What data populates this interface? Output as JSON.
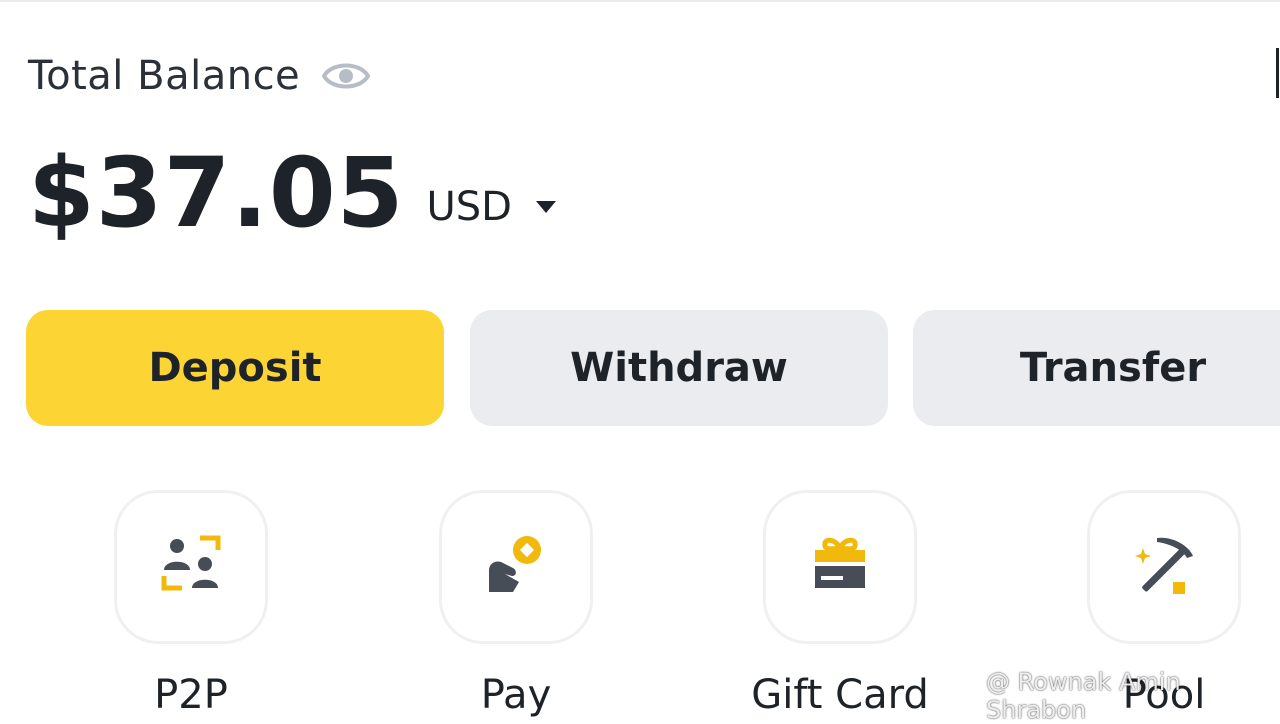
{
  "balance": {
    "label": "Total Balance",
    "amount": "$37.05",
    "currency": "USD"
  },
  "icons": {
    "visibility": "eye-icon",
    "currency_dropdown": "caret-down-icon"
  },
  "actions": {
    "deposit": "Deposit",
    "withdraw": "Withdraw",
    "transfer": "Transfer"
  },
  "shortcuts": [
    {
      "label": "P2P",
      "icon": "p2p-icon"
    },
    {
      "label": "Pay",
      "icon": "pay-icon"
    },
    {
      "label": "Gift Card",
      "icon": "gift-card-icon"
    },
    {
      "label": "Pool",
      "icon": "pickaxe-icon"
    }
  ],
  "watermark": {
    "text": "@ Rownak Amin Shrabon"
  },
  "colors": {
    "accent": "#fcd535",
    "secondary_button": "#eaecef",
    "text": "#1e2329",
    "icon_dark": "#474d57",
    "icon_accent": "#f0b90b"
  }
}
